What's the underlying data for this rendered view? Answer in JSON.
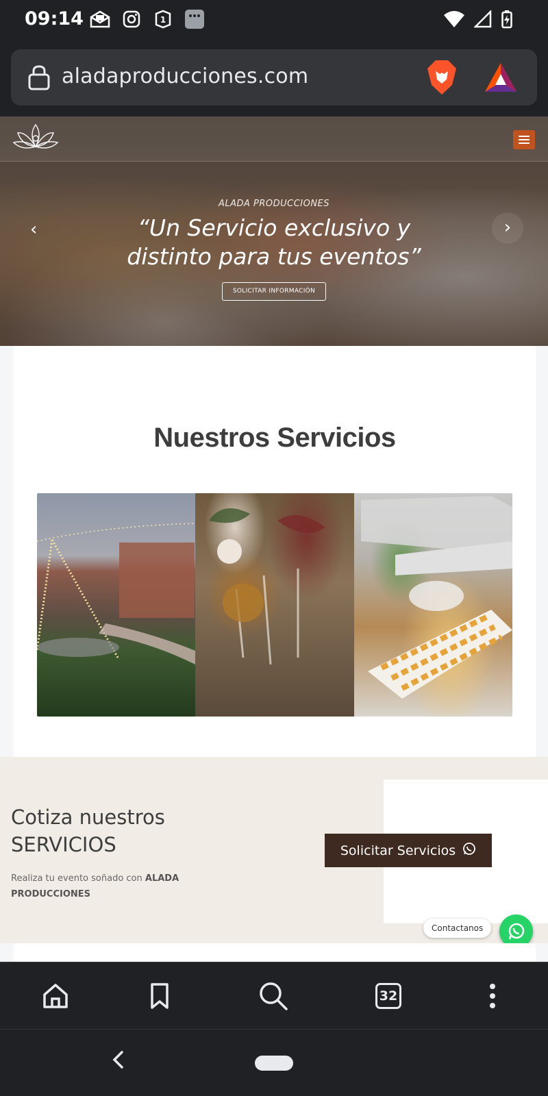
{
  "status_bar": {
    "time": "09:14",
    "left_icons": [
      "mail-icon",
      "instagram-icon",
      "onepassword-icon",
      "app-icon"
    ],
    "right_icons": [
      "wifi-icon",
      "signal-icon",
      "battery-charging-icon"
    ]
  },
  "browser": {
    "url": "aladaproducciones.com",
    "tab_count": "32"
  },
  "hero": {
    "kicker": "ALADA PRODUCCIONES",
    "title_line1": "“Un Servicio exclusivo y",
    "title_line2": "distinto para tus eventos”",
    "cta": "SOLICITAR INFORMACIÓN",
    "prev_glyph": "‹",
    "next_glyph": "›"
  },
  "services": {
    "title": "Nuestros Servicios"
  },
  "quote": {
    "title_line1": "Cotiza nuestros",
    "title_line2": "SERVICIOS",
    "sub_text": "Realiza tu evento soñado con ",
    "sub_bold": "ALADA PRODUCCIONES",
    "button_label": "Solicitar Servicios",
    "contact_label": "Contactanos"
  },
  "colors": {
    "menu_accent": "#c1541e",
    "button_dark": "#3f2a21",
    "whatsapp_green": "#25d366",
    "browser_chrome": "#202124"
  }
}
